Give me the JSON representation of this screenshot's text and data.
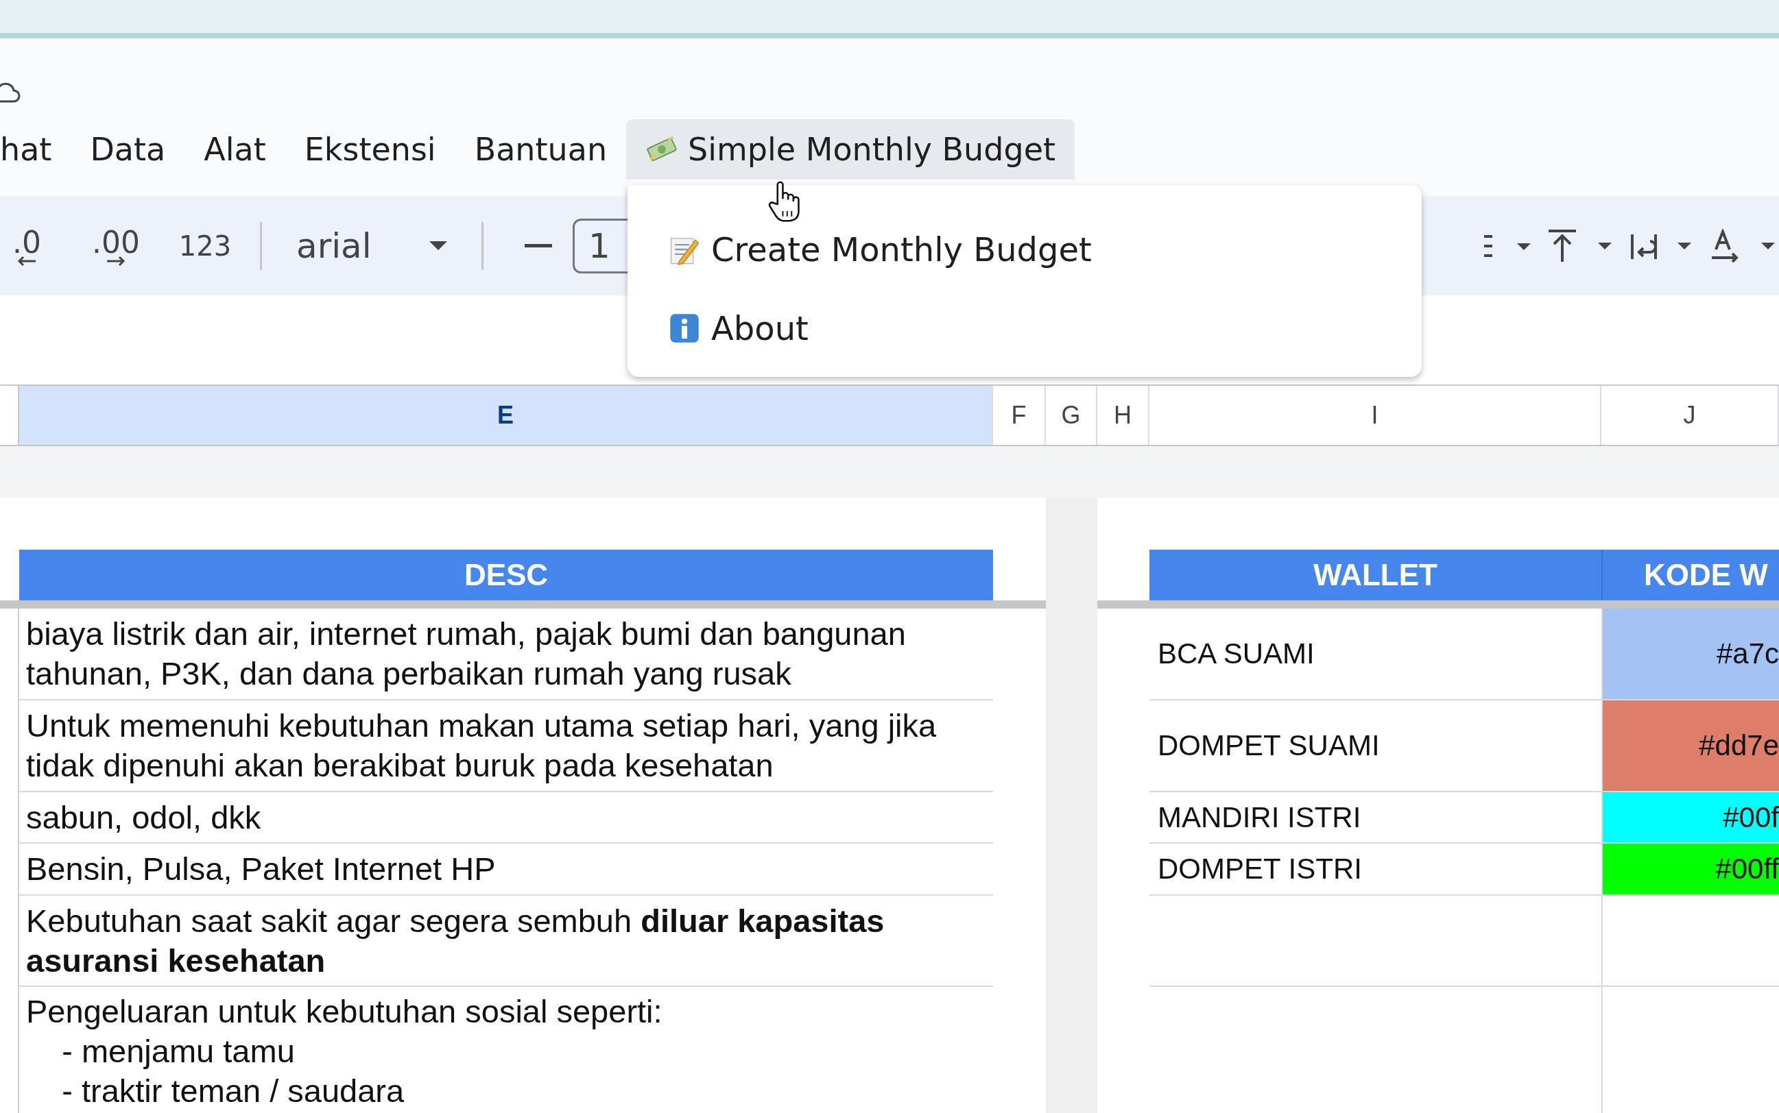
{
  "menu_bar": {
    "items": [
      {
        "label": "hat",
        "open": false
      },
      {
        "label": "Data",
        "open": false
      },
      {
        "label": "Alat",
        "open": false
      },
      {
        "label": "Ekstensi",
        "open": false
      },
      {
        "label": "Bantuan",
        "open": false
      },
      {
        "label": "Simple Monthly Budget",
        "open": true
      }
    ]
  },
  "menu_dropdown": {
    "items": [
      {
        "label": "Create Monthly Budget",
        "kind": "memo"
      },
      {
        "label": "About",
        "kind": "info"
      }
    ]
  },
  "toolbar": {
    "decrease_decimal": ".0",
    "increase_decimal": ".00",
    "number_format": "123",
    "font": "arial",
    "font_size": "1"
  },
  "column_headers": [
    {
      "label": "E",
      "selected": true
    },
    {
      "label": "F",
      "selected": false
    },
    {
      "label": "G",
      "selected": false
    },
    {
      "label": "H",
      "selected": false
    },
    {
      "label": "I",
      "selected": false
    },
    {
      "label": "J",
      "selected": false
    }
  ],
  "desc_table": {
    "header": "DESC",
    "rows": [
      "biaya listrik dan air, internet rumah, pajak bumi dan bangunan tahunan, P3K, dan dana perbaikan rumah yang rusak",
      "Untuk memenuhi kebutuhan makan utama setiap hari, yang jika tidak dipenuhi akan berakibat buruk pada kesehatan",
      "sabun, odol, dkk",
      "Bensin, Pulsa, Paket Internet HP",
      "Kebutuhan saat sakit agar segera sembuh **diluar kapasitas asuransi kesehatan**",
      "Pengeluaran untuk kebutuhan sosial seperti:\n    - menjamu tamu\n    - traktir teman / saudara"
    ]
  },
  "wallet_table": {
    "columns": [
      "WALLET",
      "KODE W"
    ],
    "rows": [
      {
        "name": "BCA SUAMI",
        "code": "#a7c",
        "color": "#a4c2f4"
      },
      {
        "name": "DOMPET SUAMI",
        "code": "#dd7e",
        "color": "#dd7e6b"
      },
      {
        "name": "MANDIRI ISTRI",
        "code": "#00f",
        "color": "#00ffff"
      },
      {
        "name": "DOMPET ISTRI",
        "code": "#00ff",
        "color": "#00ff00"
      }
    ]
  }
}
